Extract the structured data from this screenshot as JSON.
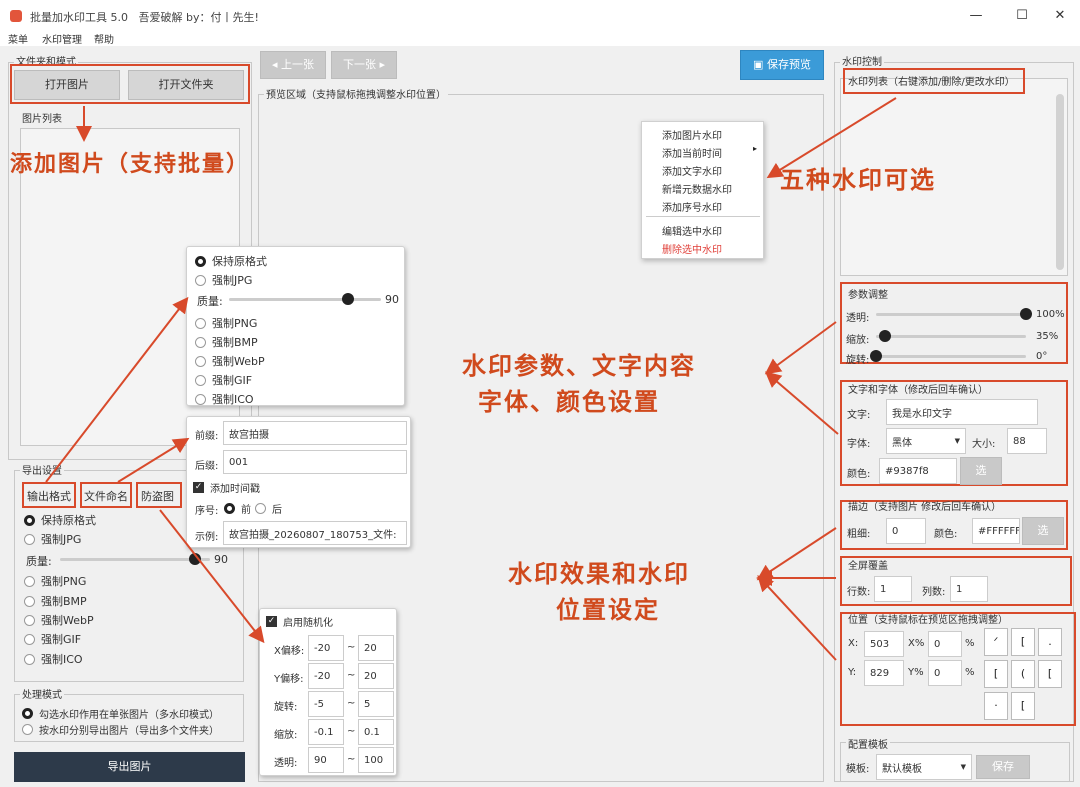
{
  "window": {
    "title": "批量加水印工具 5.0",
    "author": "吾爱破解 by：付丨先生!",
    "controls": {
      "minimize": "—",
      "maximize": "☐",
      "close": "✕"
    }
  },
  "menubar": [
    "菜单",
    "水印管理",
    "帮助"
  ],
  "left": {
    "file_group_title": "文件夹和模式",
    "open_image": "打开图片",
    "open_folder": "打开文件夹",
    "image_list_title": "图片列表",
    "export_group_title": "导出设置",
    "export_tabs": [
      "输出格式",
      "文件命名",
      "防盗图"
    ],
    "formats": [
      "保持原格式",
      "强制JPG",
      "强制PNG",
      "强制BMP",
      "强制WebP",
      "强制GIF",
      "强制ICO"
    ],
    "quality_label": "质量:",
    "quality_value": "90",
    "quality_fraction": 0.9,
    "process_group_title": "处理模式",
    "process_modes": [
      "勾选水印作用在单张图片（多水印模式）",
      "按水印分别导出图片（导出多个文件夹）"
    ],
    "export_button": "导出图片"
  },
  "center": {
    "prev": "◂ 上一张",
    "next": "下一张 ▸",
    "save_preview": "保存预览",
    "preview_title": "预览区域（支持鼠标拖拽调整水印位置）"
  },
  "context_menu": {
    "items": [
      "添加图片水印",
      "添加当前时间",
      "添加文字水印",
      "新增元数据水印",
      "添加序号水印"
    ],
    "submenu_arrow": "▸",
    "items2": [
      "编辑选中水印"
    ],
    "danger": "删除选中水印",
    "danger_color": "#e0403a"
  },
  "format_popup": {
    "formats": [
      "保持原格式",
      "强制JPG",
      "强制PNG",
      "强制BMP",
      "强制WebP",
      "强制GIF",
      "强制ICO"
    ],
    "quality_label": "质量:",
    "quality_value": "90"
  },
  "naming_popup": {
    "prefix_label": "前缀:",
    "prefix_value": "故宫拍摄",
    "suffix_label": "后缀:",
    "suffix_value": "001",
    "timestamp_label": "添加时间戳",
    "seq_label": "序号:",
    "seq_front": "前",
    "seq_back": "后",
    "example_label": "示例:",
    "example_value": "故宫拍摄_20260807_180753_文件:"
  },
  "random_popup": {
    "enable_label": "启用随机化",
    "rows": [
      {
        "label": "X偏移:",
        "min": "-20",
        "max": "20"
      },
      {
        "label": "Y偏移:",
        "min": "-20",
        "max": "20"
      },
      {
        "label": "旋转:",
        "min": "-5",
        "max": "5"
      },
      {
        "label": "缩放:",
        "min": "-0.1",
        "max": "0.1"
      },
      {
        "label": "透明:",
        "min": "90",
        "max": "100"
      }
    ],
    "tilde": "~"
  },
  "right": {
    "group_title": "水印控制",
    "list_title": "水印列表（右键添加/删除/更改水印）",
    "params_title": "参数调整",
    "params": [
      {
        "label": "透明:",
        "value": "100%",
        "fraction": 1.0
      },
      {
        "label": "缩放:",
        "value": "35%",
        "fraction": 0.06
      },
      {
        "label": "旋转:",
        "value": "0°",
        "fraction": 0.0
      }
    ],
    "text_title": "文字和字体（修改后回车确认）",
    "text_label": "文字:",
    "text_value": "我是水印文字",
    "font_label": "字体:",
    "font_value": "黑体",
    "size_label": "大小:",
    "size_value": "88",
    "color_label": "颜色:",
    "color_value": "#9387f8",
    "pick_button": "选",
    "stroke_title": "描边（支持图片 修改后回车确认）",
    "stroke_width_label": "粗细:",
    "stroke_width_value": "0",
    "stroke_color_label": "颜色:",
    "stroke_color_value": "#FFFFFF",
    "fullscreen_title": "全屏覆盖",
    "rows_label": "行数:",
    "rows_value": "1",
    "cols_label": "列数:",
    "cols_value": "1",
    "position_title": "位置（支持鼠标在预览区拖拽调整）",
    "x_label": "X:",
    "x_value": "503",
    "xp_label": "X%",
    "xp_value": "0",
    "y_label": "Y:",
    "y_value": "829",
    "yp_label": "Y%",
    "yp_value": "0",
    "percent": "%",
    "pos_buttons": [
      "ᐟ",
      "[",
      ".",
      "[",
      "(",
      "[",
      "·",
      "["
    ],
    "template_group": "配置模板",
    "template_label": "模板:",
    "template_value": "默认模板",
    "template_save": "保存"
  },
  "annotations": {
    "add_images": "添加图片（支持批量）",
    "five_types": "五种水印可选",
    "params_line1": "水印参数、文字内容",
    "params_line2": "字体、颜色设置",
    "effect_line1": "水印效果和水印",
    "effect_line2": "位置设定"
  },
  "colors": {
    "annotation": "#d04a1d",
    "accent_blue": "#3b9bd8",
    "export_dark": "#2d3a4a",
    "knob": "#222222"
  }
}
